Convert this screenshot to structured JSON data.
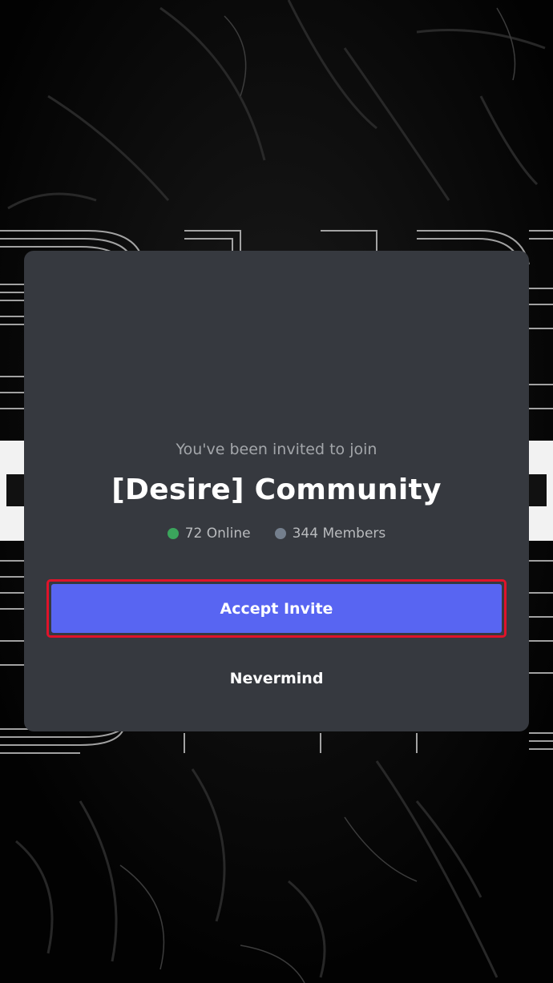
{
  "invite": {
    "subtitle": "You've been invited to join",
    "server_name": "[Desire] Community",
    "online": {
      "label": "72 Online",
      "color": "#3ba55c"
    },
    "members": {
      "label": "344 Members",
      "color": "#747f8d"
    },
    "accept_label": "Accept Invite",
    "nevermind_label": "Nevermind"
  },
  "colors": {
    "modal_bg": "#36393f",
    "accept_bg": "#5865f2",
    "highlight_border": "#e0132a"
  }
}
